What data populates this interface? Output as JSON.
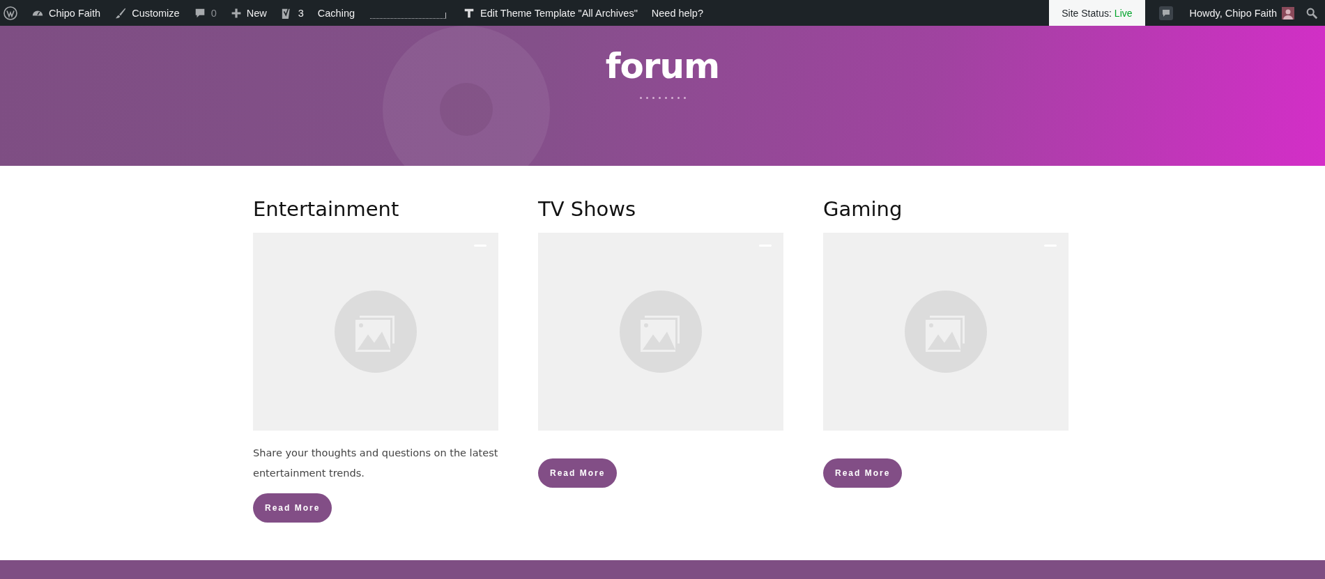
{
  "admin_bar": {
    "site_name": "Chipo Faith",
    "customize": "Customize",
    "comments": "0",
    "new": "New",
    "seo_count": "3",
    "caching": "Caching",
    "edit_template": "Edit Theme Template \"All Archives\"",
    "help": "Need help?",
    "site_status_label": "Site Status:",
    "site_status_value": "Live",
    "greeting": "Howdy, Chipo Faith"
  },
  "hero": {
    "title": "forum"
  },
  "cards": [
    {
      "title": "Entertainment",
      "description": "Share your thoughts and questions on the latest entertainment trends.",
      "button": "Read More"
    },
    {
      "title": "TV Shows",
      "button": "Read More"
    },
    {
      "title": "Gaming",
      "button": "Read More"
    }
  ]
}
